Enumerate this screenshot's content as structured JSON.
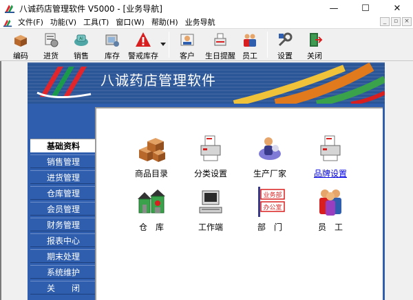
{
  "window": {
    "title": "八诚药店管理软件 V5000 - [业务导航]",
    "minimize": "—",
    "maximize": "☐",
    "close": "✕"
  },
  "menu": {
    "items": [
      "文件(F)",
      "功能(V)",
      "工具(T)",
      "窗口(W)",
      "帮助(H)",
      "业务导航"
    ],
    "mdi_buttons": [
      "_",
      "▫",
      "×"
    ]
  },
  "toolbar": {
    "buttons": [
      {
        "label": "编码",
        "icon": "product-box-icon"
      },
      {
        "label": "进货",
        "icon": "purchase-icon"
      },
      {
        "label": "销售",
        "icon": "sales-icon"
      },
      {
        "label": "库存",
        "icon": "stock-icon"
      },
      {
        "label": "警戒库存",
        "icon": "warning-icon"
      },
      {
        "label": "客户",
        "icon": "customer-icon"
      },
      {
        "label": "生日提醒",
        "icon": "birthday-icon"
      },
      {
        "label": "员工",
        "icon": "staff-icon"
      },
      {
        "label": "设置",
        "icon": "settings-icon"
      },
      {
        "label": "关闭",
        "icon": "exit-door-icon"
      }
    ]
  },
  "banner": {
    "title": "八诚药店管理软件"
  },
  "nav": {
    "items": [
      "基础资料",
      "销售管理",
      "进货管理",
      "仓库管理",
      "会员管理",
      "财务管理",
      "报表中心",
      "期末处理",
      "系统维护",
      "关　　闭"
    ],
    "active_index": 0
  },
  "content": {
    "items": [
      {
        "label": "商品目录",
        "icon": "boxes-icon",
        "link": false
      },
      {
        "label": "分类设置",
        "icon": "category-printer-icon",
        "link": false
      },
      {
        "label": "生产厂家",
        "icon": "manufacturer-icon",
        "link": false
      },
      {
        "label": "品牌设置",
        "icon": "brand-printer-icon",
        "link": true
      },
      {
        "label": "仓　库",
        "icon": "warehouse-icon",
        "link": false
      },
      {
        "label": "工作端",
        "icon": "workstation-icon",
        "link": false
      },
      {
        "label": "部　门",
        "icon": "department-icon",
        "link": false
      },
      {
        "label": "员　工",
        "icon": "employees-icon",
        "link": false
      }
    ],
    "dept_sign": {
      "line1": "业务部",
      "line2": "办公室"
    }
  },
  "colors": {
    "panel_blue": "#2f5eae",
    "banner_blue": "#2a5596",
    "warning_red": "#d81e1e",
    "link_blue": "#0000e0"
  }
}
